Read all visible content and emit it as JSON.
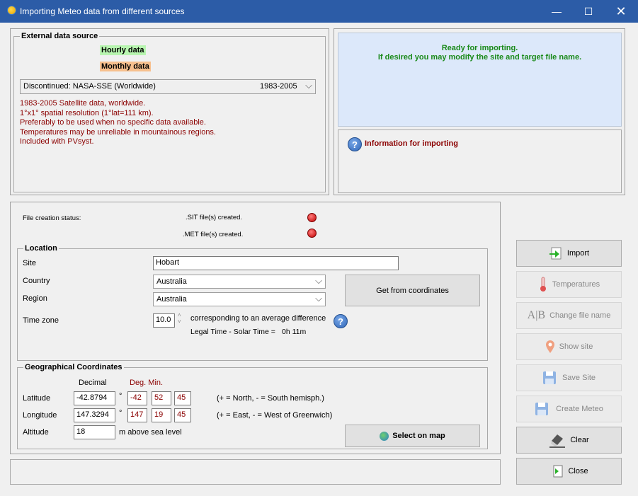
{
  "window": {
    "title": "Importing Meteo data from different sources"
  },
  "external": {
    "group_title": "External data source",
    "hourly": "Hourly data",
    "monthly": "Monthly data",
    "source_name": "Discontinued: NASA-SSE (Worldwide)",
    "source_years": "1983-2005",
    "desc": [
      "1983-2005 Satellite data, worldwide.",
      "1°x1° spatial resolution (1°lat=111 km).",
      "Preferably to be used when no specific data available.",
      "Temperatures may be unreliable in mountainous regions.",
      "Included with PVsyst."
    ]
  },
  "status_panel": {
    "line1": "Ready for importing.",
    "line2": "If desired you may modify the site and target file name.",
    "info": "Information for importing"
  },
  "file_status": {
    "label": "File creation status:",
    "sit": ".SIT file(s) created.",
    "met": ".MET file(s) created."
  },
  "location": {
    "group_title": "Location",
    "site_label": "Site",
    "site_value": "Hobart",
    "country_label": "Country",
    "country_value": "Australia",
    "region_label": "Region",
    "region_value": "Australia",
    "get_coords": "Get from coordinates",
    "tz_label": "Time zone",
    "tz_value": "10.0",
    "tz_desc1": "corresponding to an average difference",
    "tz_desc2": "Legal Time - Solar Time =",
    "tz_diff": "0h 11m"
  },
  "geo": {
    "group_title": "Geographical Coordinates",
    "decimal_hdr": "Decimal",
    "degmin_hdr": "Deg. Min.",
    "lat_label": "Latitude",
    "lat_dec": "-42.8794",
    "lat_deg": "-42",
    "lat_min": "52",
    "lat_sec": "45",
    "lat_note": "(+ = North, - = South hemisph.)",
    "lon_label": "Longitude",
    "lon_dec": "147.3294",
    "lon_deg": "147",
    "lon_min": "19",
    "lon_sec": "45",
    "lon_note": "(+ = East, - = West of Greenwich)",
    "alt_label": "Altitude",
    "alt_value": "18",
    "alt_unit": "m above sea level",
    "deg_sym": "°",
    "select_map": "Select on map"
  },
  "buttons": {
    "import": "Import",
    "temperatures": "Temperatures",
    "change_file": "Change file name",
    "show_site": "Show site",
    "save_site": "Save Site",
    "create_meteo": "Create Meteo",
    "clear": "Clear",
    "close": "Close"
  },
  "colors": {
    "titlebar": "#2c5ca7",
    "ready_green": "#1a8a1a",
    "hourly_bg": "#b8f5b0",
    "monthly_bg": "#f7c08e",
    "dark_red": "#8b0000"
  }
}
